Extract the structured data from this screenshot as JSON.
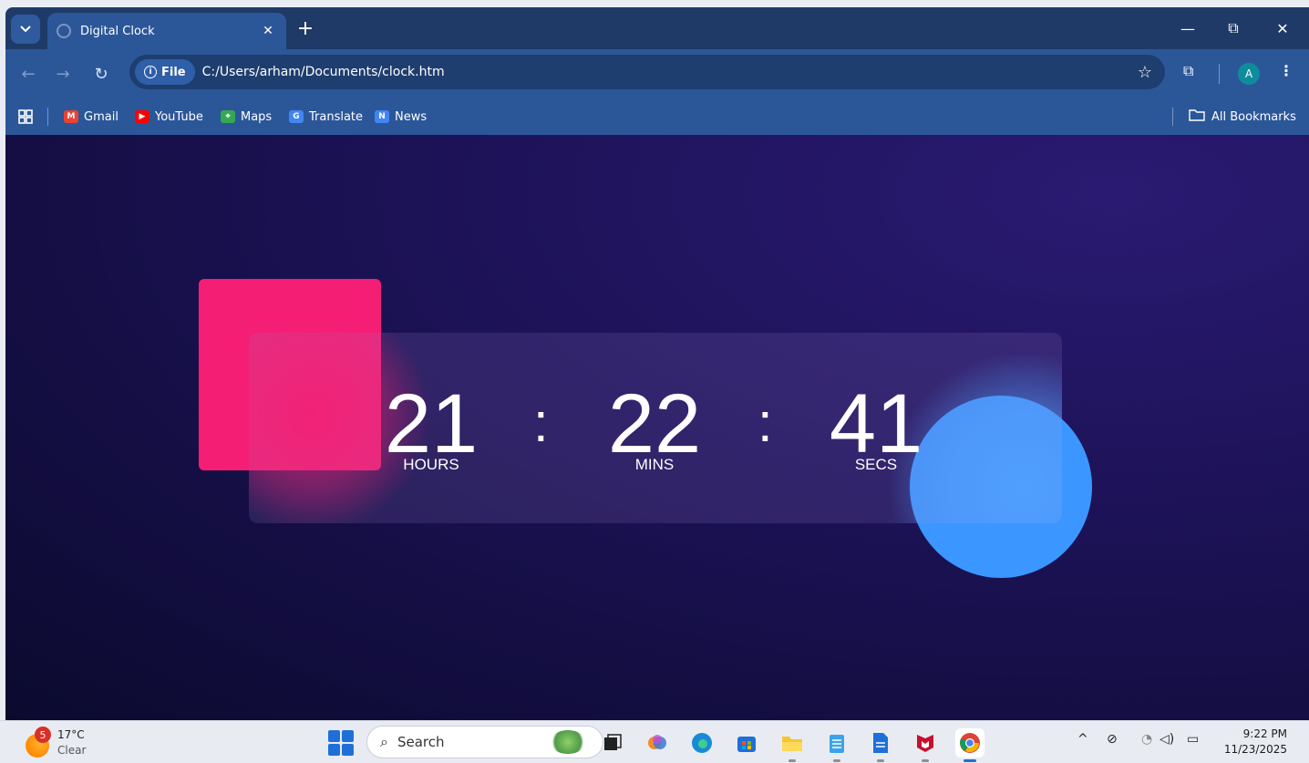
{
  "browser": {
    "tab_title": "Digital Clock",
    "tab_close": "✕",
    "new_tab": "+",
    "window_controls": {
      "minimize": "—",
      "restore": "⧉",
      "close": "✕"
    },
    "address": {
      "scheme_chip": "File",
      "url": "C:/Users/arham/Documents/clock.htm"
    },
    "profile_initial": "A",
    "bookmarks": [
      {
        "label": "Gmail",
        "icon": "gmail-icon",
        "color": "#ea4335"
      },
      {
        "label": "YouTube",
        "icon": "youtube-icon",
        "color": "#ff0000"
      },
      {
        "label": "Maps",
        "icon": "maps-icon",
        "color": "#34a853"
      },
      {
        "label": "Translate",
        "icon": "translate-icon",
        "color": "#4285f4"
      },
      {
        "label": "News",
        "icon": "news-icon",
        "color": "#4285f4"
      }
    ],
    "all_bookmarks": "All Bookmarks"
  },
  "clock": {
    "hours": "21",
    "minutes": "22",
    "seconds": "41",
    "separator": ":",
    "labels": {
      "hours": "HOURS",
      "minutes": "MINS",
      "seconds": "SECS"
    },
    "colors": {
      "square": "#f41f74",
      "circle": "#3b97ff",
      "background": "#1c1256"
    }
  },
  "taskbar": {
    "weather": {
      "temp": "17°C",
      "condition": "Clear",
      "badge": "5"
    },
    "search_placeholder": "Search",
    "apps": [
      "task-view-icon",
      "copilot-icon",
      "edge-icon",
      "store-icon",
      "file-explorer-icon",
      "notepad-icon",
      "docs-icon",
      "mcafee-icon",
      "chrome-icon"
    ],
    "time": "9:22 PM",
    "date": "11/23/2025"
  }
}
